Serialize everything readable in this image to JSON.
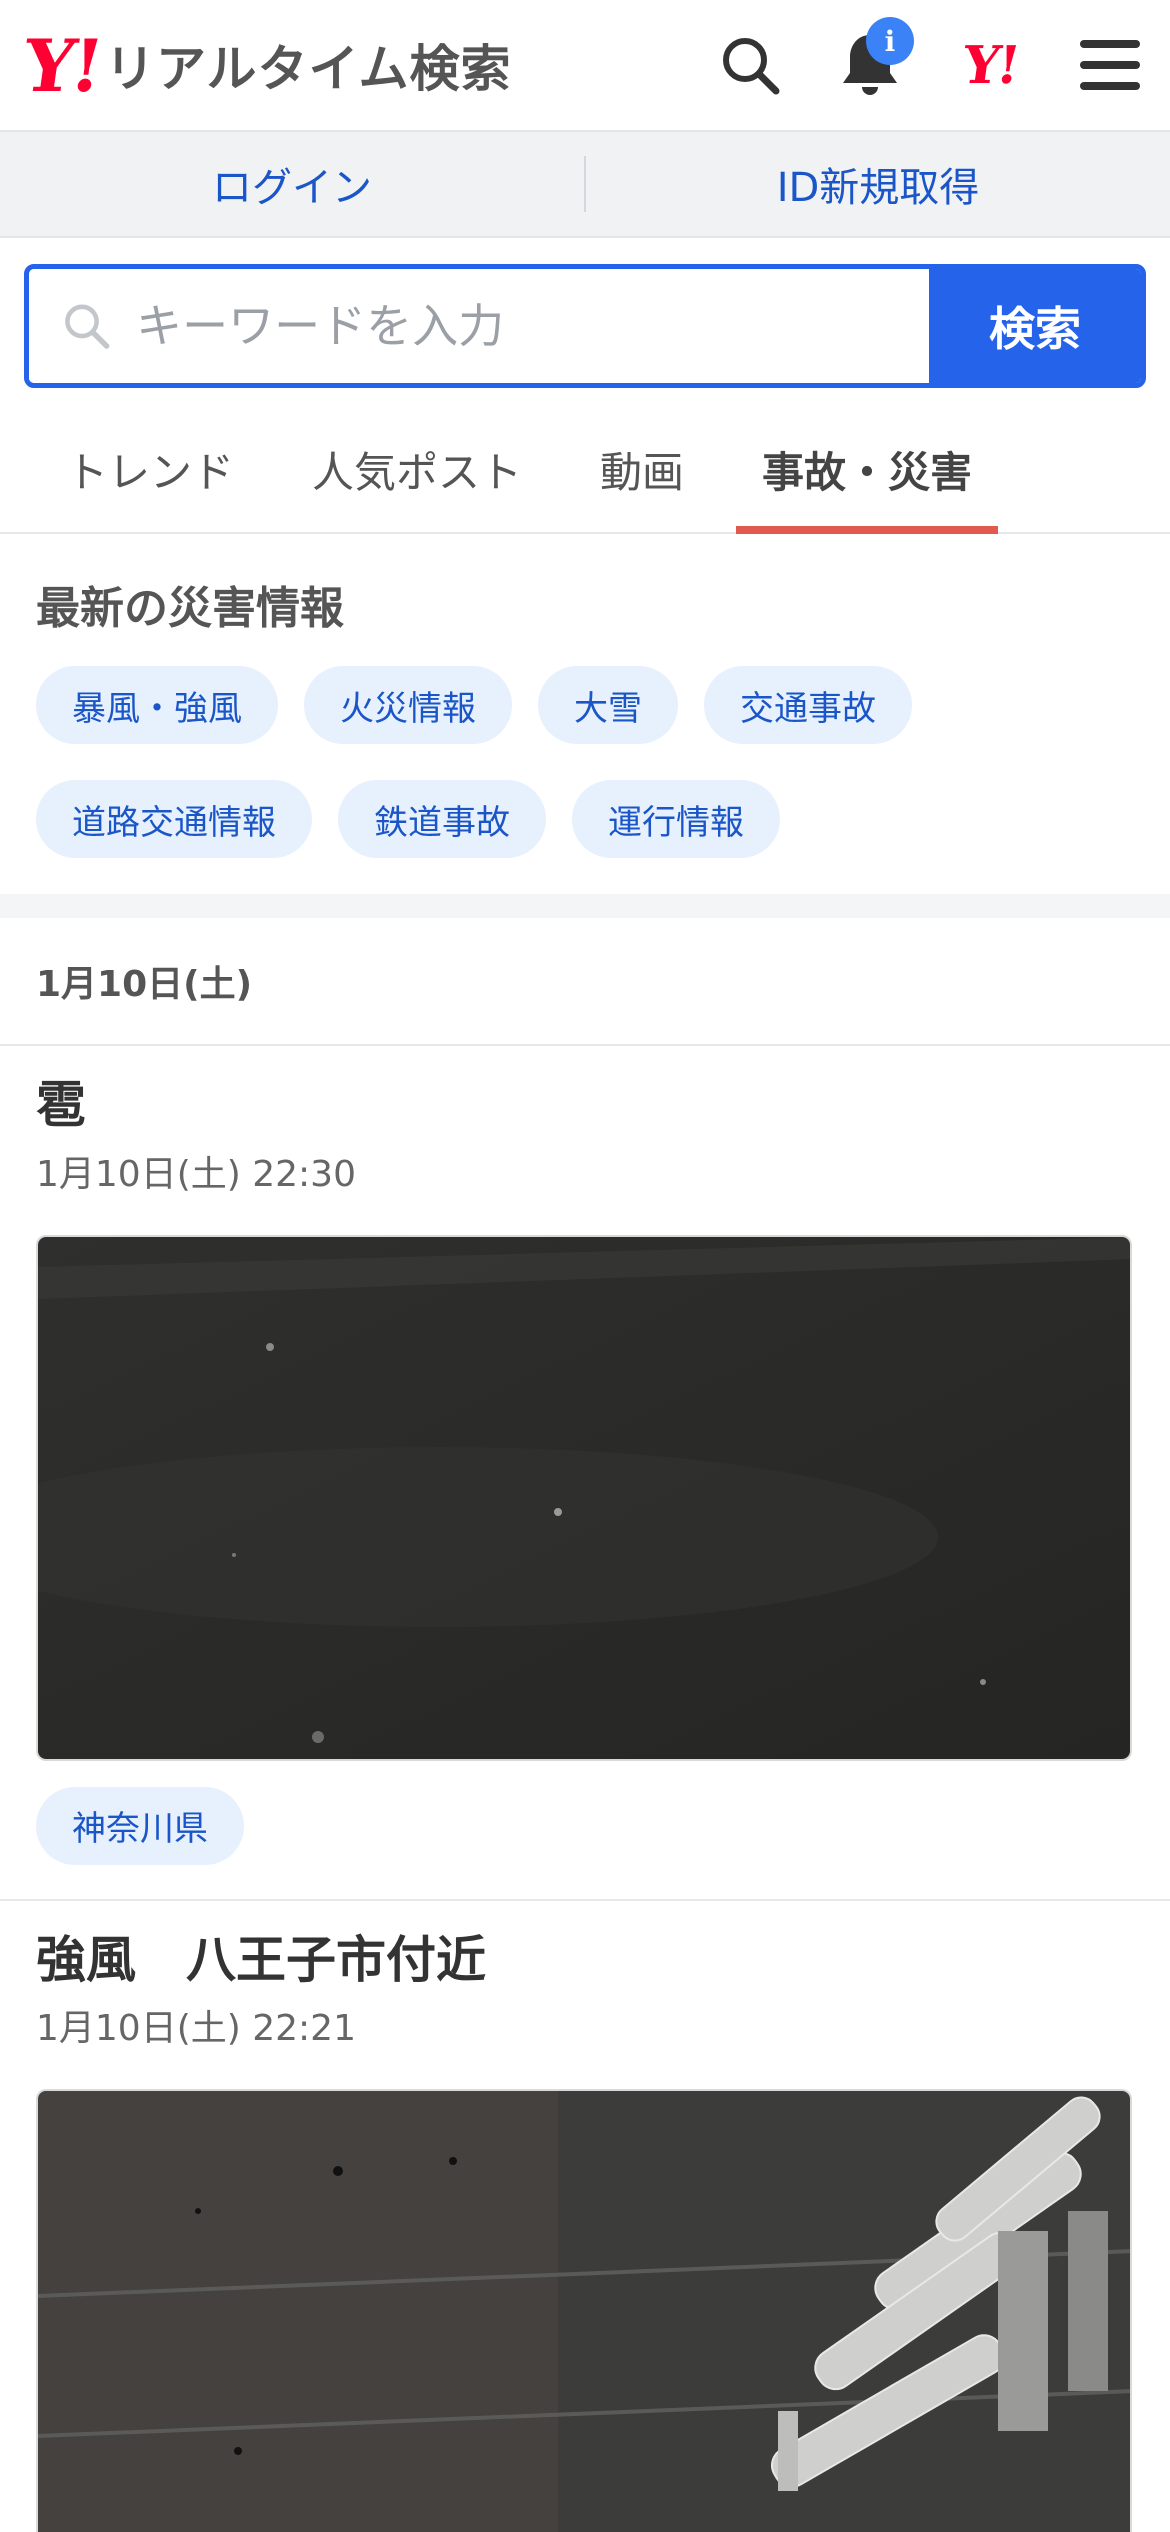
{
  "header": {
    "logo_mark": "Y!",
    "logo_text": "リアルタイム検索",
    "notification_badge": "i",
    "yahoo_mini": "Y!"
  },
  "login_bar": {
    "login": "ログイン",
    "register": "ID新規取得"
  },
  "search": {
    "placeholder": "キーワードを入力",
    "button": "検索"
  },
  "tabs": [
    {
      "label": "トレンド",
      "active": false
    },
    {
      "label": "人気ポスト",
      "active": false
    },
    {
      "label": "動画",
      "active": false
    },
    {
      "label": "事故・災害",
      "active": true
    }
  ],
  "disaster": {
    "title": "最新の災害情報",
    "chips": [
      "暴風・強風",
      "火災情報",
      "大雪",
      "交通事故",
      "道路交通情報",
      "鉄道事故",
      "運行情報"
    ]
  },
  "date_header": "1月10日(土)",
  "posts": [
    {
      "title": "雹",
      "time": "1月10日(土) 22:30",
      "tag": "神奈川県"
    },
    {
      "title": "強風　八王子市付近",
      "time": "1月10日(土) 22:21"
    }
  ],
  "colors": {
    "brand_red": "#ff0033",
    "accent_blue": "#2563eb",
    "active_tab_underline": "#e05a4f",
    "chip_bg": "#e7f0fd",
    "chip_text": "#1a56c8"
  }
}
